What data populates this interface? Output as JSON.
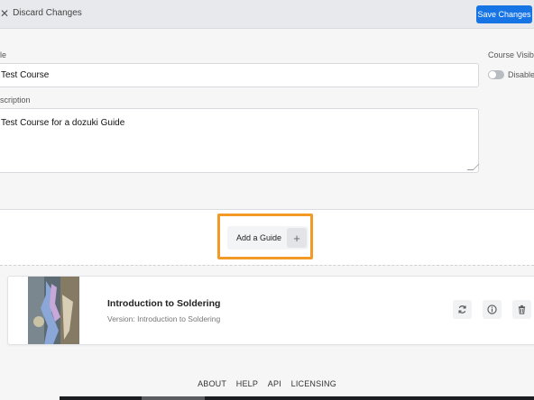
{
  "topbar": {
    "discard_label": "Discard Changes",
    "save_label": "Save Changes",
    "accent_color": "#1674e5"
  },
  "form": {
    "title_label": "le",
    "title_value": "Test Course",
    "description_label": "scription",
    "description_value": "Test Course for a dozuki Guide",
    "visibility_label": "Course Visibi",
    "visibility_state": "Disable"
  },
  "add_guide": {
    "label": "Add a Guide",
    "plus": "+",
    "highlight_color": "#f39a26"
  },
  "guide": {
    "title": "Introduction to Soldering",
    "version": "Version: Introduction to Soldering",
    "actions": [
      "refresh-icon",
      "info-icon",
      "trash-icon"
    ]
  },
  "footer": {
    "links": [
      "ABOUT",
      "HELP",
      "API",
      "LICENSING"
    ]
  }
}
